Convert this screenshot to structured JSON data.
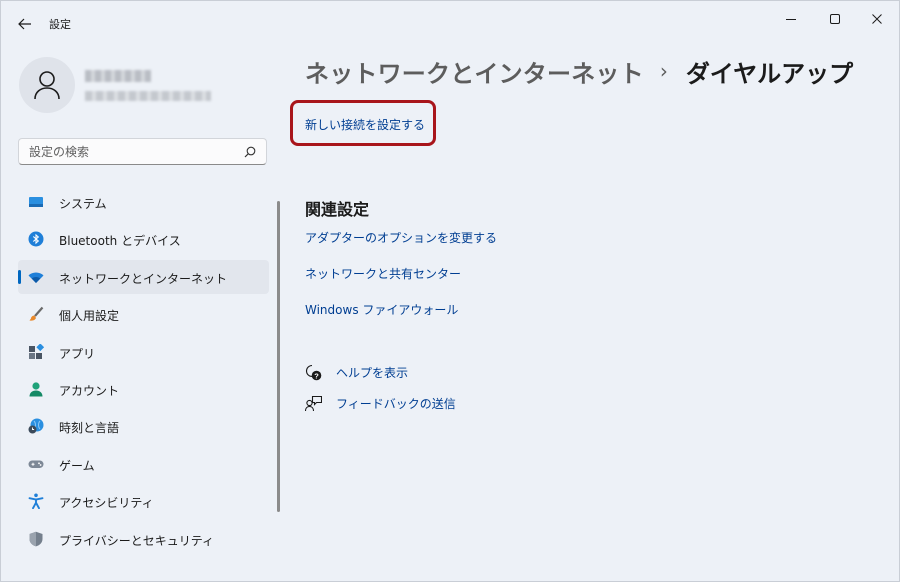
{
  "titlebar": {
    "title": "設定",
    "back_icon": "arrow-left-icon",
    "controls": [
      "minimize-icon",
      "maximize-icon",
      "close-icon"
    ]
  },
  "search": {
    "placeholder": "設定の検索",
    "value": "",
    "icon": "search-icon"
  },
  "sidebar": {
    "items": [
      {
        "label": "システム",
        "icon": "system-icon",
        "selected": false
      },
      {
        "label": "Bluetooth とデバイス",
        "icon": "bluetooth-icon",
        "selected": false
      },
      {
        "label": "ネットワークとインターネット",
        "icon": "wifi-icon",
        "selected": true
      },
      {
        "label": "個人用設定",
        "icon": "brush-icon",
        "selected": false
      },
      {
        "label": "アプリ",
        "icon": "apps-icon",
        "selected": false
      },
      {
        "label": "アカウント",
        "icon": "account-icon",
        "selected": false
      },
      {
        "label": "時刻と言語",
        "icon": "time-language-icon",
        "selected": false
      },
      {
        "label": "ゲーム",
        "icon": "gamepad-icon",
        "selected": false
      },
      {
        "label": "アクセシビリティ",
        "icon": "accessibility-icon",
        "selected": false
      },
      {
        "label": "プライバシーとセキュリティ",
        "icon": "shield-icon",
        "selected": false
      }
    ]
  },
  "main": {
    "breadcrumb_parent": "ネットワークとインターネット",
    "breadcrumb_separator": "›",
    "breadcrumb_current": "ダイヤルアップ",
    "new_connection_link": "新しい接続を設定する",
    "related_title": "関連設定",
    "related_links": [
      "アダプターのオプションを変更する",
      "ネットワークと共有センター",
      "Windows ファイアウォール"
    ],
    "help_label": "ヘルプを表示",
    "feedback_label": "フィードバックの送信"
  },
  "colors": {
    "accent": "#0067c0",
    "link": "#003e92",
    "highlight": "#a8151b",
    "background": "#edf1f7"
  }
}
